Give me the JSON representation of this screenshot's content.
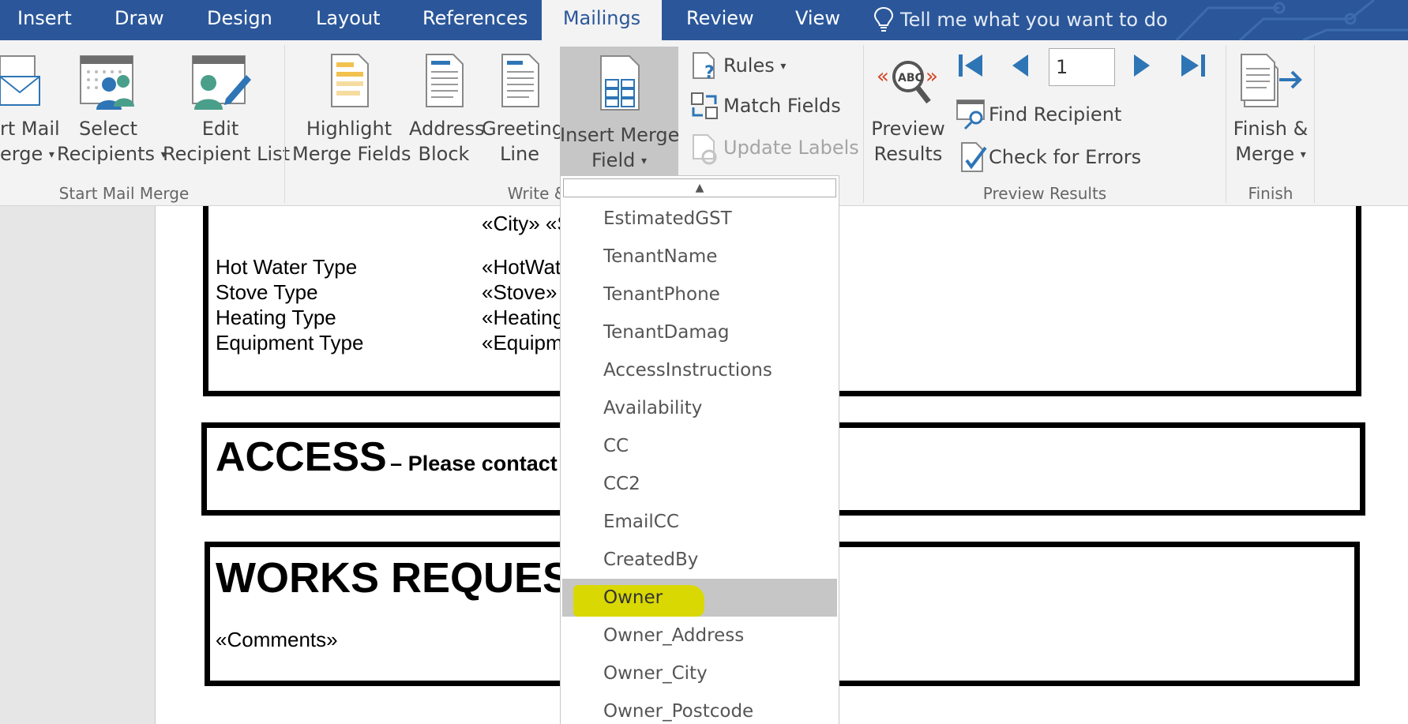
{
  "tabs": [
    "Insert",
    "Draw",
    "Design",
    "Layout",
    "References",
    "Mailings",
    "Review",
    "View"
  ],
  "active_tab": "Mailings",
  "tell_me": "Tell me what you want to do",
  "ribbon": {
    "start_mail_merge": {
      "group_label": "Start Mail Merge",
      "start_line1": "rt Mail",
      "start_line2": "erge",
      "select_line1": "Select",
      "select_line2": "Recipients",
      "edit_line1": "Edit",
      "edit_line2": "Recipient List"
    },
    "write_insert": {
      "group_label": "Write &",
      "highlight_line1": "Highlight",
      "highlight_line2": "Merge Fields",
      "address_line1": "Address",
      "address_line2": "Block",
      "greeting_line1": "Greeting",
      "greeting_line2": "Line",
      "insert_line1": "Insert Merge",
      "insert_line2": "Field",
      "rules": "Rules",
      "match_fields": "Match Fields",
      "update_labels": "Update Labels"
    },
    "preview_results": {
      "group_label": "Preview Results",
      "preview_line1": "Preview",
      "preview_line2": "Results",
      "record_number": "1",
      "find_recipient": "Find Recipient",
      "check_errors": "Check for Errors"
    },
    "finish": {
      "group_label": "Finish",
      "finish_line1": "Finish &",
      "finish_line2": "Merge"
    }
  },
  "document": {
    "city_field": "«City» «S",
    "rows": [
      {
        "label": "Hot Water Type",
        "value": "«HotWat"
      },
      {
        "label": "Stove Type",
        "value": "«Stove»"
      },
      {
        "label": "Heating Type",
        "value": "«Heating"
      },
      {
        "label": "Equipment Type",
        "value": "«Equipm"
      }
    ],
    "access_heading": "ACCESS",
    "access_sub": "– Please contact",
    "works_heading": "WORKS REQUES",
    "comments_field": "«Comments»"
  },
  "merge_field_menu": {
    "items": [
      "EstimatedGST",
      "TenantName",
      "TenantPhone",
      "TenantDamag",
      "AccessInstructions",
      "Availability",
      "CC",
      "CC2",
      "EmailCC",
      "CreatedBy",
      "Owner",
      "Owner_Address",
      "Owner_City",
      "Owner_Postcode"
    ],
    "selected": "Owner"
  },
  "colors": {
    "accent": "#2b579a",
    "highlight": "#d9d802",
    "arrow_blue": "#2e75b6",
    "preview_red": "#d24726"
  }
}
